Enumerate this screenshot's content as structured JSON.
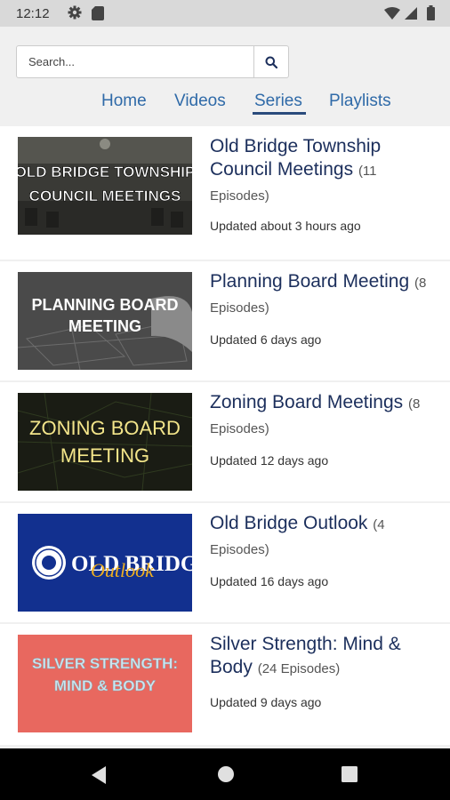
{
  "status_bar": {
    "time": "12:12",
    "icons": [
      "gear-icon",
      "sd-card-icon",
      "wifi-icon",
      "signal-icon",
      "battery-icon"
    ]
  },
  "search": {
    "placeholder": "Search...",
    "button_icon": "search-icon"
  },
  "tabs": [
    {
      "label": "Home",
      "active": false
    },
    {
      "label": "Videos",
      "active": false
    },
    {
      "label": "Series",
      "active": true
    },
    {
      "label": "Playlists",
      "active": false
    }
  ],
  "series": [
    {
      "title": "Old Bridge Township Council Meetings",
      "episodes": "(11 Episodes)",
      "updated": "Updated about 3 hours ago",
      "thumb_text": [
        "OLD BRIDGE TOWNSHIP",
        "COUNCIL MEETINGS"
      ]
    },
    {
      "title": "Planning Board Meeting",
      "episodes": "(8 Episodes)",
      "updated": "Updated 6 days ago",
      "thumb_text": [
        "PLANNING BOARD",
        "MEETING"
      ]
    },
    {
      "title": "Zoning Board Meetings",
      "episodes": "(8 Episodes)",
      "updated": "Updated 12 days ago",
      "thumb_text": [
        "ZONING BOARD",
        "MEETING"
      ]
    },
    {
      "title": "Old Bridge Outlook",
      "episodes": "(4 Episodes)",
      "updated": "Updated 16 days ago",
      "thumb_text": [
        "OLD BRIDGE",
        "Outlook"
      ]
    },
    {
      "title": "Silver Strength: Mind & Body",
      "episodes": "(24 Episodes)",
      "updated": "Updated 9 days ago",
      "thumb_text": [
        "SILVER STRENGTH:",
        "MIND & BODY"
      ]
    }
  ],
  "nav_bar": {
    "icons": [
      "back-icon",
      "home-icon",
      "recents-icon"
    ]
  },
  "colors": {
    "accent": "#2f6aa8",
    "title": "#1c2f5c"
  }
}
